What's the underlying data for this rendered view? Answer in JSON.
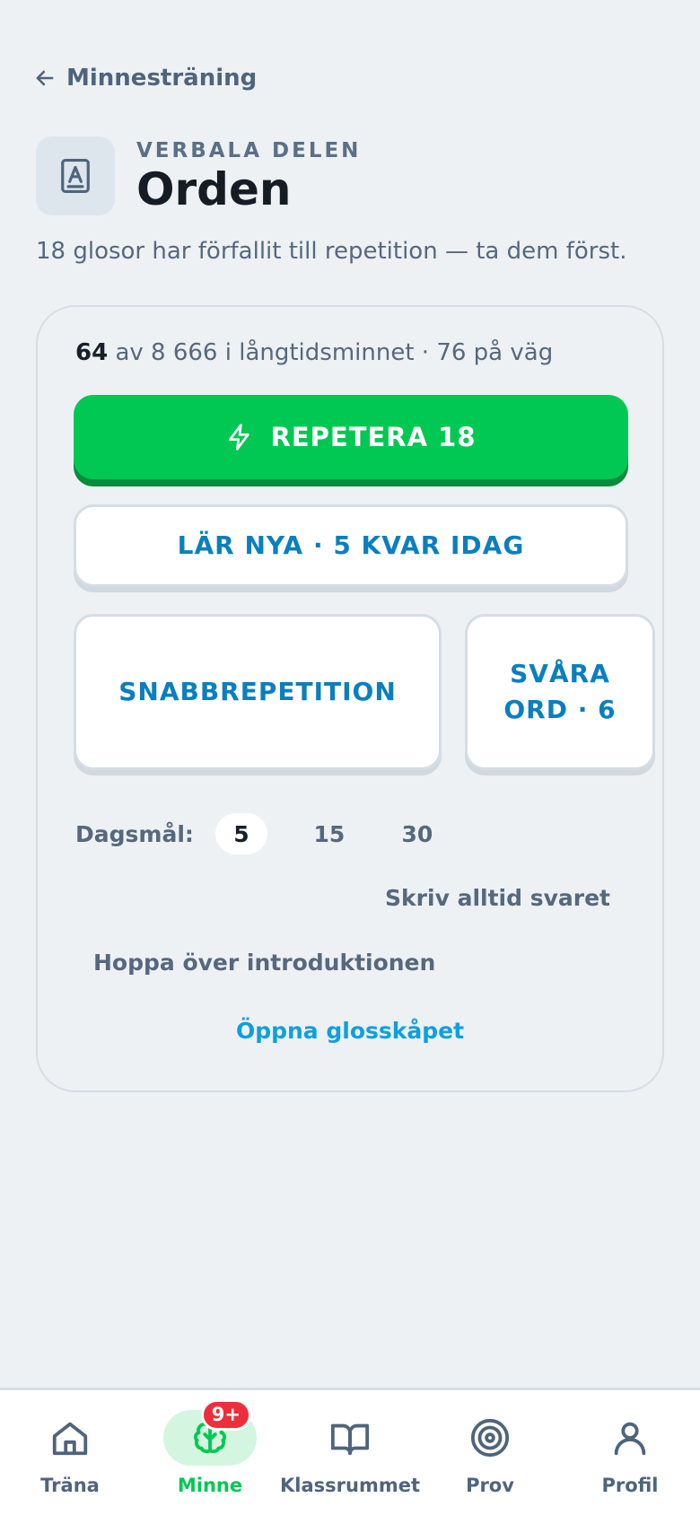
{
  "back": {
    "label": "Minnesträning",
    "icon": "arrow-left-icon"
  },
  "header": {
    "eyebrow": "VERBALA DELEN",
    "title": "Orden",
    "icon": "book-icon",
    "subtitle": "18 glosor har förfallit till repetition — ta dem först."
  },
  "card": {
    "stats": {
      "learned": "64",
      "rest": " av 8 666 i långtidsminnet · 76 på väg"
    },
    "review_button": {
      "label": "REPETERA 18",
      "icon": "lightning-icon"
    },
    "learn_button": "LÄR NYA · 5 KVAR IDAG",
    "quick_button": "SNABBREPETITION",
    "hard_button": "SVÅRA ORD · 6",
    "goal": {
      "label": "Dagsmål:",
      "options": [
        "5",
        "15",
        "30"
      ],
      "selected": "5"
    },
    "option_write": "Skriv alltid svaret",
    "option_skip": "Hoppa över introduktionen",
    "open_link": "Öppna glosskåpet"
  },
  "nav": {
    "items": [
      {
        "label": "Träna",
        "icon": "home-icon",
        "active": false
      },
      {
        "label": "Minne",
        "icon": "brain-icon",
        "active": true,
        "badge": "9+"
      },
      {
        "label": "Klassrummet",
        "icon": "open-book-icon",
        "active": false
      },
      {
        "label": "Prov",
        "icon": "target-icon",
        "active": false
      },
      {
        "label": "Profil",
        "icon": "user-icon",
        "active": false
      }
    ]
  },
  "colors": {
    "background": "#edf1f4",
    "primary_green": "#00c853",
    "link_blue": "#0a7fbf",
    "badge_red": "#ef2e3c"
  }
}
